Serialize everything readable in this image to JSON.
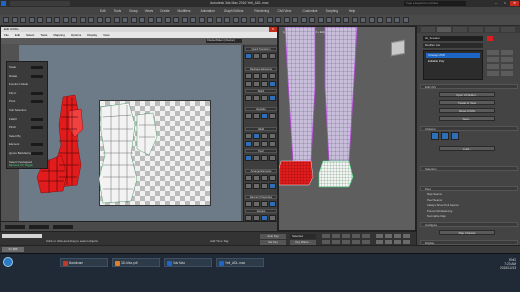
{
  "app": {
    "title": "Autodesk 3ds Max 2016    Yeti_ADL.max",
    "search_placeholder": "Type a keyword or phrase"
  },
  "main_menu": [
    "Edit",
    "Tools",
    "Group",
    "Views",
    "Create",
    "Modifiers",
    "Animation",
    "Graph Editors",
    "Rendering",
    "Civil View",
    "Customize",
    "Scripting",
    "Help"
  ],
  "uvw_editor": {
    "title": "Edit UVWs",
    "menu": [
      "File",
      "Edit",
      "Select",
      "Tools",
      "Mapping",
      "Options",
      "Display",
      "View"
    ],
    "texture_dropdown": "CheckerPattern (Checker)",
    "side_panel": {
      "rows": [
        "Scale",
        "Rotate",
        "Freeform Mode",
        "Flip U",
        "Pivot",
        "Soft Selection",
        "Falloff",
        "Pinch",
        "Select By",
        "Element",
        "Ignore Backfacing",
        "Select Overlapped"
      ],
      "selected_label": "Element UV Toggle"
    },
    "right_panel": {
      "sections": [
        "Quick Transform",
        "Reshape Elements",
        "Stitch",
        "Explode",
        "Weld",
        "Peel",
        "Arrange Elements",
        "Element Properties",
        "Groups"
      ],
      "padding_label": "Padding",
      "padding_value": "0.0",
      "no_groups": "No groups selected"
    }
  },
  "viewport": {
    "label": "[+] [Perspective] [Shaded + Edged Faces]"
  },
  "command_panel": {
    "object_name": "tbl_Sneaker",
    "modifier_list": "Modifier List",
    "stack": [
      "Unwrap UVW",
      "Editable Poly"
    ],
    "rollouts": [
      "Edit UVs",
      "Channel",
      "Selection",
      "Peel",
      "Configure",
      "Display",
      "Map Channel"
    ],
    "channel_value": "1",
    "config_options": [
      "Map Seams",
      "Peel Seams",
      "Always Show Pelt Seams",
      "Prevent Reflattening",
      "Normalize Map"
    ],
    "buttons": [
      "Open UV Editor...",
      "Tweak In View",
      "Reset UVWs",
      "Save...",
      "Load...",
      "Map Channel"
    ]
  },
  "status": {
    "frame": "0 / 100",
    "message": "Click or click-and-drag to select objects",
    "add_time_tag": "Add Time Tag",
    "auto_key": "Auto Key",
    "set_key": "Set Key",
    "selected": "Selected",
    "key_filters": "Key Filters..."
  },
  "taskbar": {
    "items": [
      "Bandicam",
      "3D-Max.pdf",
      "3ds Max",
      "Yeti_ADL.max"
    ],
    "time": "7:23 AM",
    "date": "2015/12/13",
    "locale": "ENG"
  },
  "colors": {
    "accent": "#1b66c7",
    "selection_red": "#e21c1c",
    "uv_white": "#f3f3f3",
    "green_mesh": "#37d77b",
    "wire_magenta": "#b54bd8"
  }
}
